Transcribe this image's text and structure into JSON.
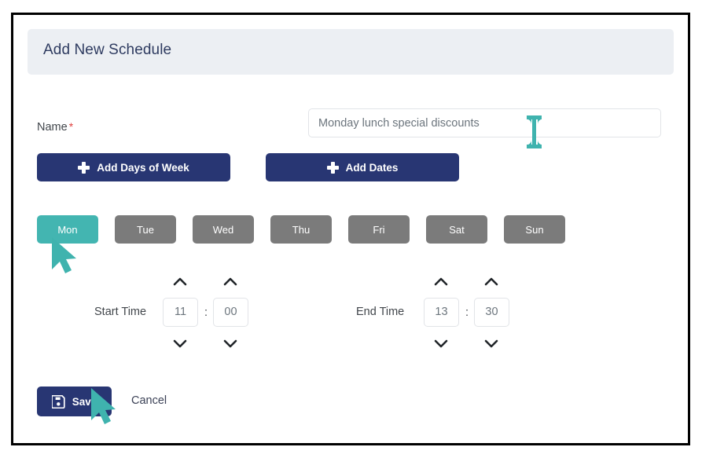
{
  "header": {
    "title": "Add New Schedule"
  },
  "form": {
    "name_label": "Name",
    "required_marker": "*",
    "name_value": "Monday lunch special discounts",
    "name_placeholder": "Monday lunch special discounts"
  },
  "actions": {
    "add_days_of_week": "Add Days of Week",
    "add_dates": "Add Dates"
  },
  "days": [
    {
      "label": "Mon",
      "selected": true
    },
    {
      "label": "Tue",
      "selected": false
    },
    {
      "label": "Wed",
      "selected": false
    },
    {
      "label": "Thu",
      "selected": false
    },
    {
      "label": "Fri",
      "selected": false
    },
    {
      "label": "Sat",
      "selected": false
    },
    {
      "label": "Sun",
      "selected": false
    }
  ],
  "start_time": {
    "label": "Start Time",
    "hours": "11",
    "separator": ":",
    "minutes": "00"
  },
  "end_time": {
    "label": "End Time",
    "hours": "13",
    "separator": ":",
    "minutes": "30"
  },
  "footer": {
    "save_label": "Save",
    "cancel_label": "Cancel"
  },
  "colors": {
    "navy": "#283673",
    "teal": "#43b5b1",
    "chip_gray": "#7b7b7b",
    "header_bg": "#eceff3",
    "required_red": "#e0413f",
    "text_gray": "#6c757d"
  }
}
